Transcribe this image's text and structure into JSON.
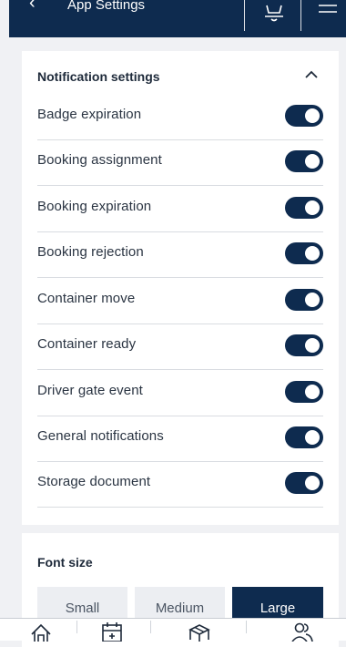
{
  "header": {
    "title": "App Settings",
    "back_icon": "chevron-left-icon",
    "actions": [
      "bell-icon",
      "menu-icon"
    ]
  },
  "notifications": {
    "title": "Notification settings",
    "collapse_icon": "chevron-up-icon",
    "items": [
      {
        "label": "Badge expiration",
        "enabled": true
      },
      {
        "label": "Booking assignment",
        "enabled": true
      },
      {
        "label": "Booking expiration",
        "enabled": true
      },
      {
        "label": "Booking rejection",
        "enabled": true
      },
      {
        "label": "Container move",
        "enabled": true
      },
      {
        "label": "Container ready",
        "enabled": true
      },
      {
        "label": "Driver gate event",
        "enabled": true
      },
      {
        "label": "General notifications",
        "enabled": true
      },
      {
        "label": "Storage document",
        "enabled": true
      }
    ]
  },
  "font_size": {
    "title": "Font size",
    "options": [
      "Small",
      "Medium",
      "Large"
    ],
    "selected": "Large"
  },
  "bottom_nav": {
    "items": [
      "home-icon",
      "calendar-icon",
      "box-icon",
      "users-icon"
    ]
  },
  "colors": {
    "primary": "#0e2b4f",
    "background": "#f0f1f4",
    "card": "#ffffff",
    "divider": "#d9dce1"
  }
}
